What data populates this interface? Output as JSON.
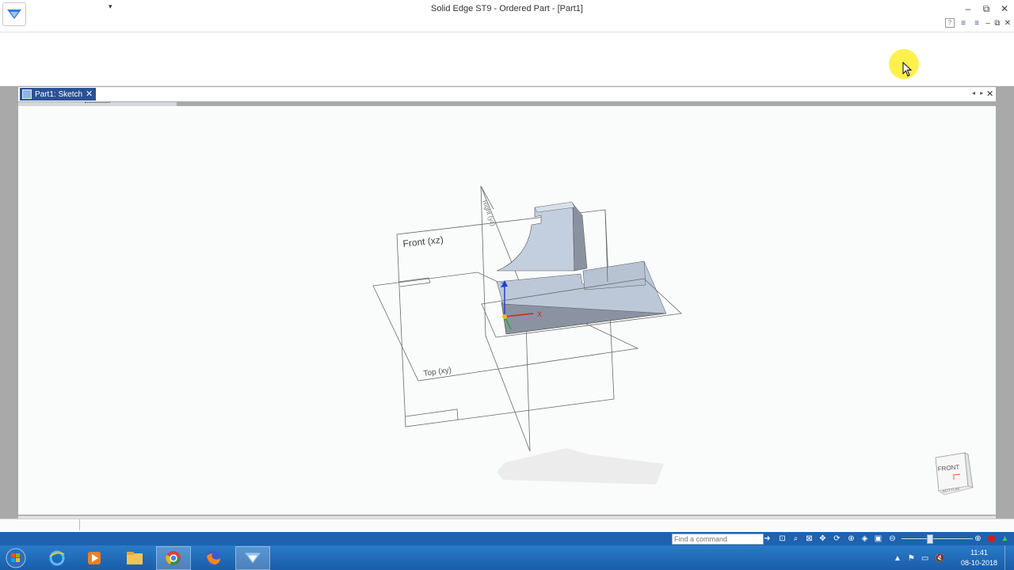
{
  "window": {
    "title": "Solid Edge ST9 - Ordered Part - [Part1]",
    "app_icon": "solid-edge-logo",
    "qat_dropdown": "▾",
    "controls": {
      "minimize": "–",
      "restore": "⧉",
      "close": "✕"
    },
    "doc_controls": {
      "help": "?",
      "arrange": "≡",
      "cascade": "≡",
      "minimize": "–",
      "restore": "⧉",
      "close": "✕"
    }
  },
  "document": {
    "tab_label": "Part1: Sketch",
    "tab_close": "✕",
    "pane_nav": "◂ ▸",
    "pane_close": "✕"
  },
  "viewport": {
    "plane_front_label": "Front (xz)",
    "plane_top_label": "Top (xy)",
    "plane_right_label": "Right (yz)",
    "triad": {
      "x": "X",
      "z": "Z"
    },
    "view_cube_face": "FRONT",
    "view_cube_bottom": "BOTTOM",
    "colors": {
      "part_face": "#bcc8d8",
      "part_side": "#8b93a2",
      "plane_edge": "#6a6a6a",
      "x_axis": "#d62020",
      "y_axis": "#22aa22",
      "z_axis": "#2040d0"
    }
  },
  "command_bar": {
    "find_placeholder": "Find a command",
    "icons": [
      "arrow-right-icon",
      "zoom-area-icon",
      "zoom-icon",
      "fit-icon",
      "pan-icon",
      "rotate-icon",
      "spin-icon",
      "view-orient-icon",
      "shade-icon",
      "display-icon",
      "zoom-out-icon",
      "zoom-in-icon",
      "record-icon",
      "marker-icon"
    ]
  },
  "taskbar": {
    "apps": [
      "windows-start-icon",
      "internet-explorer-icon",
      "media-player-icon",
      "file-explorer-icon",
      "chrome-icon",
      "firefox-icon",
      "solid-edge-icon"
    ],
    "time": "11:41",
    "date": "08-10-2018",
    "tray_chevron": "▲"
  }
}
